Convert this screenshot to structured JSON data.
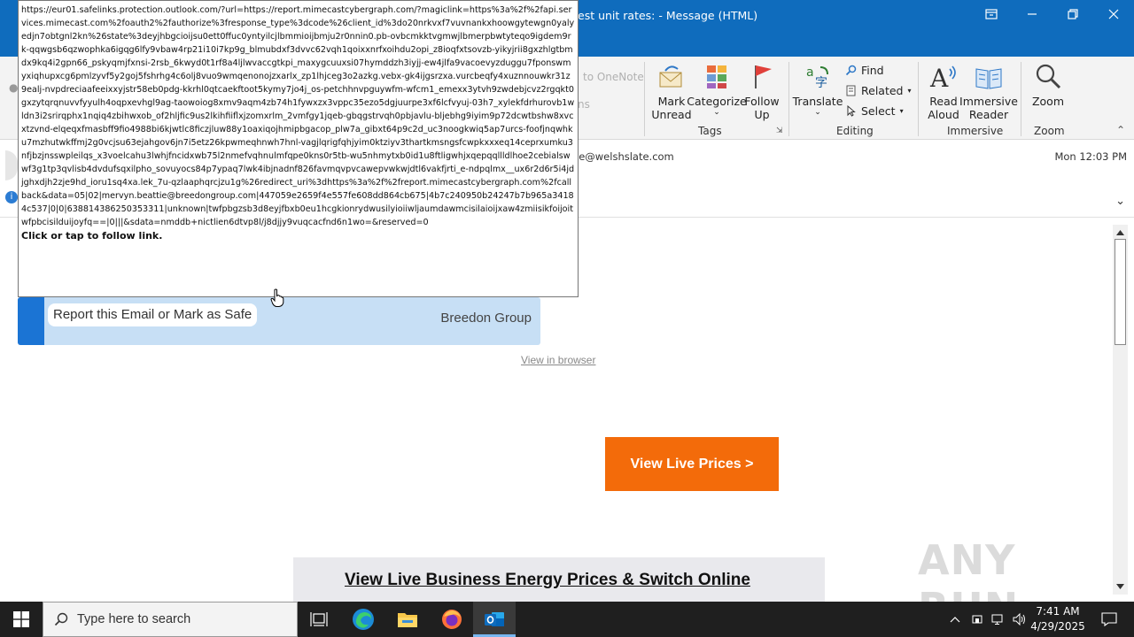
{
  "window": {
    "title": "est unit rates:  -  Message (HTML)"
  },
  "ribbon": {
    "faded_onenote": "to OneNote",
    "faded_arrow": "ns",
    "mark_unread": [
      "Mark",
      "Unread"
    ],
    "categorize": [
      "Categorize"
    ],
    "follow_up": [
      "Follow",
      "Up"
    ],
    "translate": "Translate",
    "find": "Find",
    "related": "Related",
    "select": "Select",
    "read_aloud": [
      "Read",
      "Aloud"
    ],
    "immersive_reader": [
      "Immersive",
      "Reader"
    ],
    "zoom": "Zoom",
    "groups": {
      "tags": "Tags",
      "editing": "Editing",
      "immersive": "Immersive",
      "zoom": "Zoom"
    }
  },
  "message": {
    "from_email": "ie@welshslate.com",
    "date": "Mon 12:03 PM"
  },
  "email_body": {
    "report_button": "Report this Email or Mark as Safe",
    "brand": "Breedon Group",
    "view_in_browser": "View in browser",
    "cta": "View Live Prices >",
    "headline": "View Live Business Energy Prices & Switch Online",
    "watermark": "ANY RUN"
  },
  "tooltip": {
    "url": "https://eur01.safelinks.protection.outlook.com/?url=https://report.mimecastcybergraph.com/?magiclink=https%3a%2f%2fapi.services.mimecast.com%2foauth2%2fauthorize%3fresponse_type%3dcode%26client_id%3do20nrkvxf7vuvnankxhoowgytewgn0yalyedjn7obtgnl2kn%26state%3deyjhbgcioijsu0ett0ffuc0yntyilcjlbmmioijbmju2r0nnin0.pb-ovbcmkktvgmwjlbmerpbwtyteqo9igdem9rk-qqwgsb6qzwophka6igqg6lfy9vbaw4rp21i10i7kp9g_blmubdxf3dvvc62vqh1qoixxnrfxoihdu2opi_z8ioqfxtsovzb-yikyjrii8gxzhlgtbmdx9kq4i2gpn66_pskyqmjfxnsi-2rsb_6kwyd0t1rf8a4ljlwvaccgtkpi_maxygcuuxsi07hymddzh3iyjj-ew4jlfa9vacoevyzduggu7fponswmyxiqhupxcg6pmlzyvf5y2goj5fshrhg4c6olj8vuo9wmqenonojzxarlx_zp1lhjceg3o2azkg.vebx-gk4ijgsrzxa.vurcbeqfy4xuznnouwkr31z9ealj-nvpdreciaafeeixxyjstr58eb0pdg-kkrhl0qtcaekftoot5kymy7jo4j_os-petchhnvpguywfm-wfcm1_emexx3ytvh9zwdebjcvz2rgqkt0gxzytqrqnuvvfyyulh4oqpxevhgl9ag-taowoiog8xmv9aqm4zb74h1fywxzx3vppc35ezo5dgjuurpe3xf6lcfvyuj-03h7_xylekfdrhurovb1wldn3i2srirqphx1nqiq4zbihwxob_of2hljfic9us2lkihfiiflxjzomxrlm_2vmfgy1jqeb-gbqgstrvqh0pbjavlu-bljebhg9iyim9p72dcwtbshw8xvcxtzvnd-elqeqxfmasbff9fio4988bi6kjwtlc8ficzjluw88y1oaxiqojhmipbgacop_plw7a_gibxt64p9c2d_uc3noogkwiq5ap7urcs-foofjnqwhku7mzhutwkffmj2g0vcjsu63ejahgov6jn7i5etz26kpwmeqhnwh7hnl-vagjlqrigfqhjyim0ktziyv3thartkmsngsfcwpkxxxeq14ceprxumku3nfjbzjnsswpleilqs_x3voelcahu3lwhjfncidxwb75l2nmefvqhnulmfqpe0kns0r5tb-wu5nhmytxb0id1u8ftligwhjxqepqqllldlhoe2cebialswwf3g1tp3qvlisb4dvdufsqxilpho_sovuyocs84p7ypaq7lwk4ibjnadnf826favmqvpvcawepvwkwjdtl6vakfjrti_e-ndpqlmx__ux6r2d6r5i4jdjghxdjh2zje9hd_ioru1sq4xa.lek_7u-qzlaaphqrcjzu1g%26redirect_uri%3dhttps%3a%2f%2freport.mimecastcybergraph.com%2fcallback&data=05|02|mervyn.beattie@breedongroup.com|447059e2659f4e557fe608dd864cb675|4b7c240950b24247b7b965a34184c537|0|0|638814386250353311|unknown|twfpbgzsb3d8eyjfbxb0eu1hcgkionrydwusilyioiiwljaumdawmcisilaioijxaw4zmiisikfoijoitwfpbcisilduijoyfq==|0|||&sdata=nmddb+nictlien6dtvp8l/j8djjy9vuqcacfnd6n1wo=&reserved=0",
    "hint": "Click or tap to follow link."
  },
  "taskbar": {
    "search_placeholder": "Type here to search",
    "time": "7:41 AM",
    "date": "4/29/2025"
  }
}
